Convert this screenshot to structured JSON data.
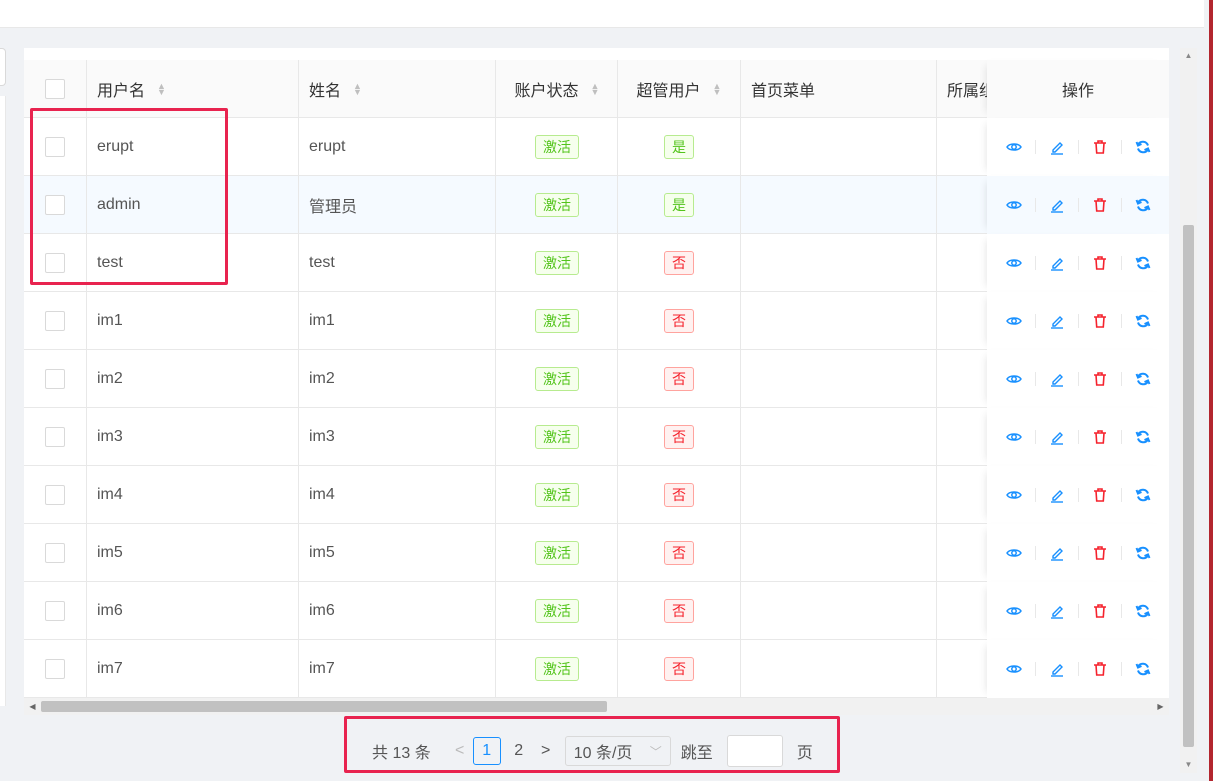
{
  "table": {
    "headers": {
      "username": "用户名",
      "name": "姓名",
      "status": "账户状态",
      "superuser": "超管用户",
      "home_menu": "首页菜单",
      "org": "所属组",
      "ops": "操作"
    },
    "rows": [
      {
        "username": "erupt",
        "name": "erupt",
        "status": "激活",
        "superuser": "是"
      },
      {
        "username": "admin",
        "name": "管理员",
        "status": "激活",
        "superuser": "是"
      },
      {
        "username": "test",
        "name": "test",
        "status": "激活",
        "superuser": "否"
      },
      {
        "username": "im1",
        "name": "im1",
        "status": "激活",
        "superuser": "否"
      },
      {
        "username": "im2",
        "name": "im2",
        "status": "激活",
        "superuser": "否"
      },
      {
        "username": "im3",
        "name": "im3",
        "status": "激活",
        "superuser": "否"
      },
      {
        "username": "im4",
        "name": "im4",
        "status": "激活",
        "superuser": "否"
      },
      {
        "username": "im5",
        "name": "im5",
        "status": "激活",
        "superuser": "否"
      },
      {
        "username": "im6",
        "name": "im6",
        "status": "激活",
        "superuser": "否"
      },
      {
        "username": "im7",
        "name": "im7",
        "status": "激活",
        "superuser": "否"
      }
    ],
    "op_icons": [
      "eye-icon",
      "edit-icon",
      "delete-icon",
      "reset-password-icon"
    ]
  },
  "pagination": {
    "total": "共 13 条",
    "prev": "<",
    "pages": [
      "1",
      "2"
    ],
    "current": "1",
    "next": ">",
    "page_size": "10 条/页",
    "jump_label": "跳至",
    "page_label": "页"
  },
  "colors": {
    "accent": "#1890ff",
    "tag_green": "#52c41a",
    "tag_red": "#f5222d",
    "annotation_box": "#e8234f"
  }
}
